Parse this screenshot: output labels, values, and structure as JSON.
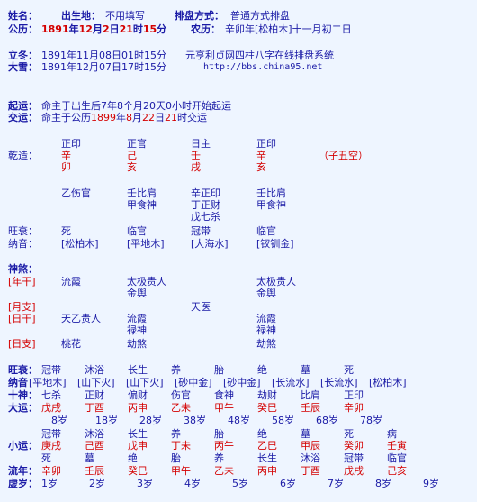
{
  "header": {
    "name_label": "姓名：",
    "birthplace_label": "出生地：",
    "birthplace_value": "不用填写",
    "layout_label": "排盘方式：",
    "layout_value": "普通方式排盘",
    "solar_label": "公历：",
    "solar_year": "1891",
    "solar_year_unit": "年",
    "solar_month": "12",
    "solar_month_unit": "月",
    "solar_day": "2",
    "solar_day_unit": "日",
    "solar_hour": "21",
    "solar_hour_unit": "时",
    "solar_minute": "15",
    "solar_minute_unit": "分",
    "lunar_label": "农历：",
    "lunar_value": "辛卯年[松柏木]十一月初二日"
  },
  "terms": {
    "lichun_label": "立冬：",
    "lichun_value": "1891年11月08日01时15分",
    "daxue_label": "大雪：",
    "daxue_value": "1891年12月07日17时15分",
    "site_title": "元亨利贞网四柱八字在线排盘系统",
    "site_url": "http://bbs.china95.net"
  },
  "qiyun": {
    "qiyun_label": "起运：",
    "qiyun_value": "命主于出生后7年8个月20天0小时开始起运",
    "jiaoyun_label": "交运：",
    "jiaoyun_prefix": "命主于公历",
    "jiaoyun_year": "1899",
    "jiaoyun_mid": "年",
    "jiaoyun_month": "8",
    "jiaoyun_mid2": "月",
    "jiaoyun_day": "22",
    "jiaoyun_mid3": "日",
    "jiaoyun_hour": "21",
    "jiaoyun_suffix": "时交运"
  },
  "qianzao": {
    "label": "乾造：",
    "shishen": [
      "正印",
      "正官",
      "日主",
      "正印"
    ],
    "gan": [
      "辛",
      "己",
      "壬",
      "辛"
    ],
    "zhi": [
      "卯",
      "亥",
      "戌",
      "亥"
    ],
    "kong": "（子丑空）",
    "canggan": [
      [
        "乙伤官"
      ],
      [
        "壬比肩",
        "甲食神"
      ],
      [
        "辛正印",
        "丁正财",
        "戊七杀"
      ],
      [
        "壬比肩",
        "甲食神"
      ]
    ],
    "wangshuai_label": "旺衰：",
    "wangshuai": [
      "死",
      "临官",
      "冠带",
      "临官"
    ],
    "nayin_label": "纳音：",
    "nayin": [
      "[松柏木]",
      "[平地木]",
      "[大海水]",
      "[钗钏金]"
    ]
  },
  "shensha": {
    "label": "神煞：",
    "niangan_label": "[年干]",
    "niangan_items": [
      "流霞",
      "太极贵人",
      "金舆",
      "太极贵人",
      "金舆"
    ],
    "yuezhi_label": "[月支]",
    "yuezhi_items": [
      "天医"
    ],
    "rigan_label": "[日干]",
    "rigan_items": [
      "天乙贵人",
      "流霞",
      "禄神",
      "流霞",
      "禄神"
    ],
    "rizhi_label": "[日支]",
    "rizhi_items": [
      "桃花",
      "劫煞",
      "劫煞"
    ]
  },
  "dayun": {
    "wangshuai_label": "旺衰：",
    "wangshuai": [
      "冠带",
      "沐浴",
      "长生",
      "养",
      "胎",
      "绝",
      "墓",
      "死"
    ],
    "nayin_label": "纳音",
    "nayin": [
      "[平地木]",
      "[山下火]",
      "[山下火]",
      "[砂中金]",
      "[砂中金]",
      "[长流水]",
      "[长流水]",
      "[松柏木]"
    ],
    "shishen_label": "十神：",
    "shishen": [
      "七杀",
      "正财",
      "偏财",
      "伤官",
      "食神",
      "劫财",
      "比肩",
      "正印"
    ],
    "dayun_label": "大运：",
    "dayun": [
      "戊戌",
      "丁酉",
      "丙申",
      "乙未",
      "甲午",
      "癸巳",
      "壬辰",
      "辛卯"
    ],
    "ages": [
      "8岁",
      "18岁",
      "28岁",
      "38岁",
      "48岁",
      "58岁",
      "68岁",
      "78岁"
    ]
  },
  "xiaoyun": {
    "top_row": [
      "冠带",
      "沐浴",
      "长生",
      "养",
      "胎",
      "绝",
      "墓",
      "死",
      "病"
    ],
    "label": "小运：",
    "ganzhi": [
      "庚戌",
      "己酉",
      "戊申",
      "丁未",
      "丙午",
      "乙巳",
      "甲辰",
      "癸卯",
      "壬寅"
    ],
    "bottom_row": [
      "死",
      "墓",
      "绝",
      "胎",
      "养",
      "长生",
      "沐浴",
      "冠带",
      "临官"
    ],
    "liunian_label": "流年：",
    "liunian": [
      "辛卯",
      "壬辰",
      "癸巳",
      "甲午",
      "乙未",
      "丙申",
      "丁酉",
      "戊戌",
      "己亥"
    ],
    "xusui_label": "虚岁：",
    "xusui": [
      "1岁",
      "2岁",
      "3岁",
      "4岁",
      "5岁",
      "6岁",
      "7岁",
      "8岁",
      "9岁"
    ]
  }
}
